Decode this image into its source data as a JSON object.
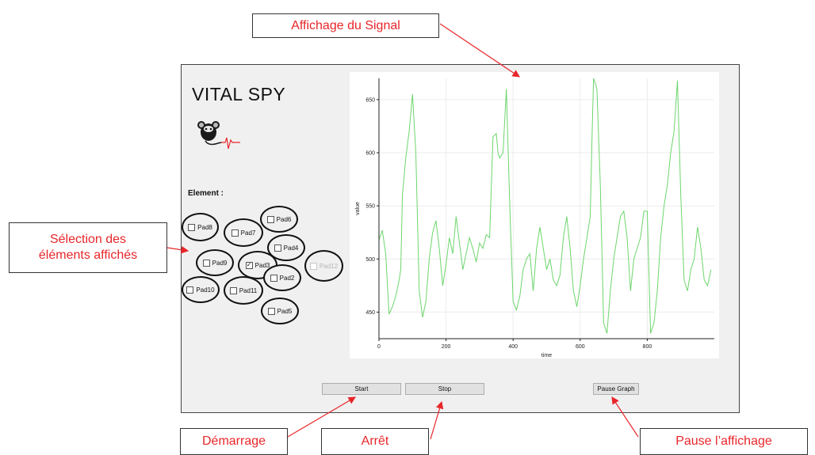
{
  "annotations": {
    "signal_display": "Affichage du Signal",
    "element_selection": "Sélection des éléments affichés",
    "start": "Démarrage",
    "stop": "Arrêt",
    "pause": "Pause l’affichage"
  },
  "app": {
    "title": "VITAL SPY",
    "logo_icon": "mouse-heartbeat-icon",
    "element_label": "Element :",
    "pads": [
      {
        "label": "Pad8",
        "checked": false,
        "enabled": true
      },
      {
        "label": "Pad7",
        "checked": false,
        "enabled": true
      },
      {
        "label": "Pad6",
        "checked": false,
        "enabled": true
      },
      {
        "label": "Pad4",
        "checked": false,
        "enabled": true
      },
      {
        "label": "Pad9",
        "checked": false,
        "enabled": true
      },
      {
        "label": "Pad3",
        "checked": true,
        "enabled": true
      },
      {
        "label": "Pad12",
        "checked": false,
        "enabled": false
      },
      {
        "label": "Pad2",
        "checked": false,
        "enabled": true
      },
      {
        "label": "Pad10",
        "checked": false,
        "enabled": true
      },
      {
        "label": "Pad11",
        "checked": false,
        "enabled": true
      },
      {
        "label": "Pad5",
        "checked": false,
        "enabled": true
      }
    ],
    "buttons": {
      "start": "Start",
      "stop": "Stop",
      "pause": "Pause Graph"
    }
  },
  "chart_data": {
    "type": "line",
    "xlabel": "time",
    "ylabel": "value",
    "xlim": [
      0,
      1000
    ],
    "ylim": [
      425,
      670
    ],
    "xticks": [
      0,
      200,
      400,
      600,
      800
    ],
    "yticks": [
      450,
      500,
      550,
      600,
      650
    ],
    "grid": true,
    "line_color": "#6cd66c",
    "series": [
      {
        "x": [
          0,
          10,
          20,
          30,
          40,
          50,
          60,
          65,
          70,
          80,
          90,
          100,
          110,
          120,
          130,
          140,
          150,
          160,
          170,
          180,
          190,
          200,
          210,
          220,
          230,
          240,
          250,
          260,
          270,
          280,
          290,
          300,
          310,
          320,
          330,
          340,
          350,
          355,
          360,
          370,
          380,
          390,
          400,
          410,
          420,
          430,
          440,
          450,
          460,
          470,
          480,
          490,
          500,
          510,
          520,
          530,
          540,
          550,
          560,
          570,
          580,
          590,
          600,
          610,
          620,
          630,
          635,
          640,
          650,
          660,
          670,
          680,
          690,
          700,
          710,
          720,
          730,
          740,
          750,
          760,
          770,
          780,
          790,
          800,
          810,
          820,
          830,
          840,
          850,
          860,
          870,
          880,
          890,
          900,
          910,
          920,
          930,
          940,
          950,
          960,
          970,
          980,
          990
        ],
        "y": [
          518,
          527,
          505,
          448,
          455,
          465,
          480,
          490,
          560,
          595,
          620,
          655,
          600,
          470,
          445,
          460,
          500,
          525,
          536,
          510,
          475,
          495,
          520,
          505,
          540,
          515,
          490,
          505,
          520,
          510,
          497,
          515,
          510,
          523,
          520,
          615,
          618,
          600,
          595,
          600,
          660,
          550,
          460,
          452,
          465,
          490,
          500,
          505,
          470,
          510,
          530,
          510,
          490,
          500,
          480,
          475,
          485,
          520,
          540,
          510,
          470,
          455,
          475,
          500,
          520,
          540,
          610,
          670,
          660,
          570,
          440,
          430,
          470,
          500,
          520,
          540,
          545,
          520,
          470,
          500,
          510,
          520,
          545,
          545,
          430,
          440,
          470,
          520,
          550,
          570,
          600,
          620,
          668,
          560,
          480,
          470,
          490,
          500,
          530,
          510,
          480,
          475,
          490
        ]
      }
    ]
  }
}
